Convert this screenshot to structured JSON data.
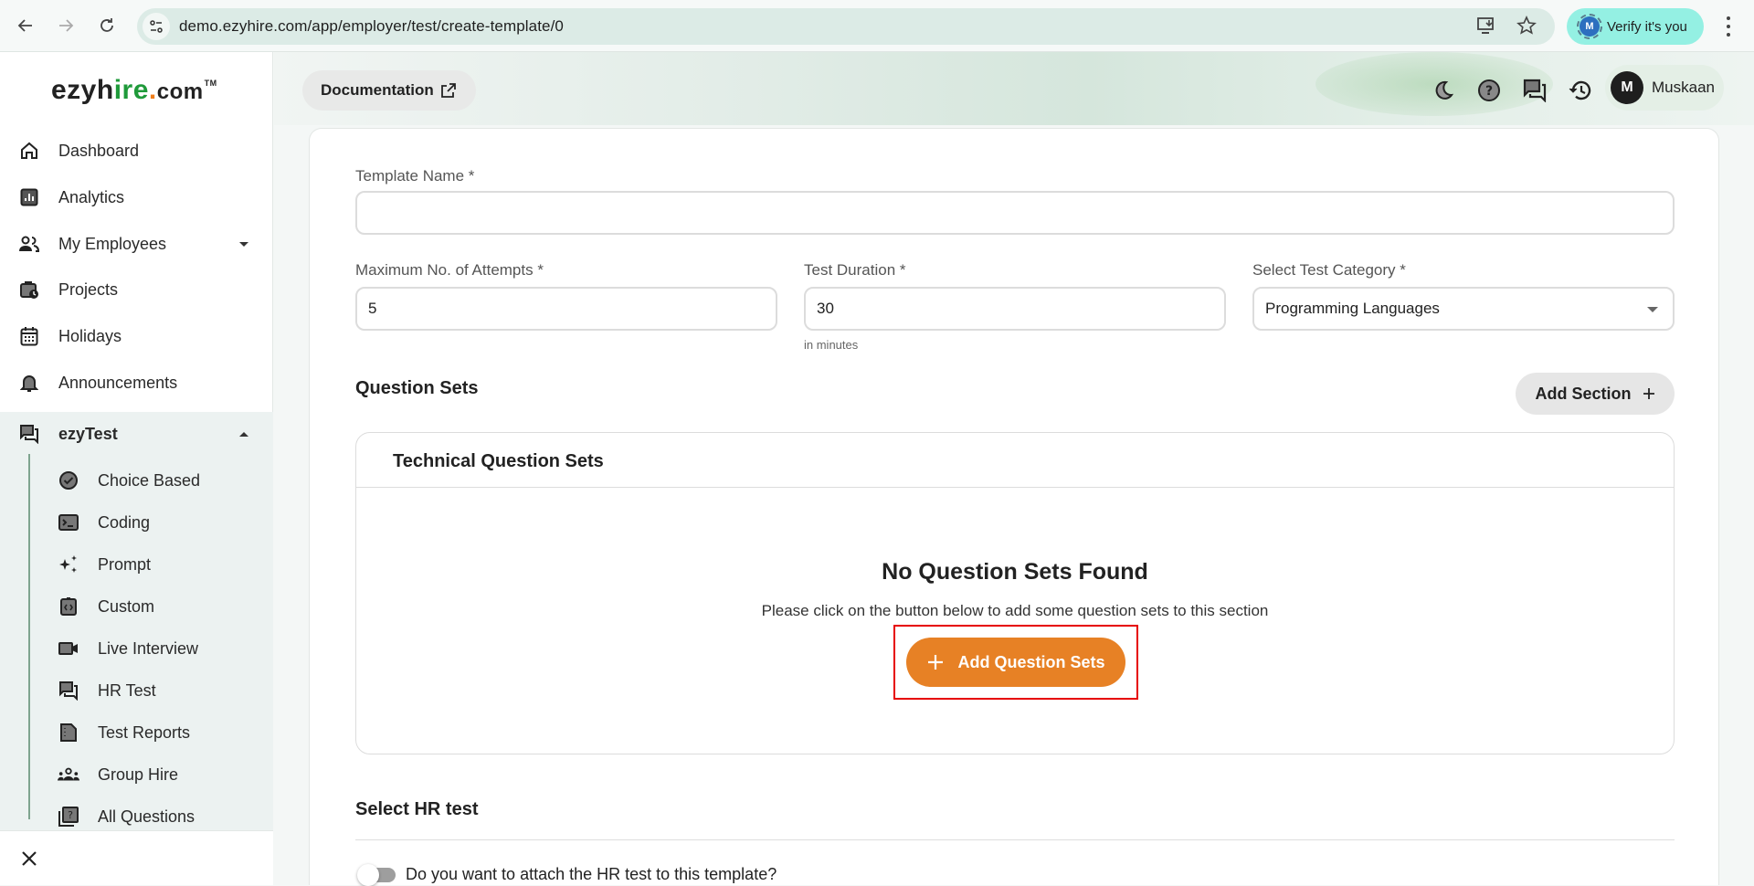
{
  "browser": {
    "url": "demo.ezyhire.com/app/employer/test/create-template/0",
    "profile_button": "Verify it's you",
    "profile_initial": "M"
  },
  "sidebar": {
    "logo": {
      "part1": "ezyh",
      "part2": "ire",
      "dot": ".",
      "part3": "com",
      "tm": "TM"
    },
    "items": [
      {
        "label": "Dashboard",
        "icon": "home-icon"
      },
      {
        "label": "Analytics",
        "icon": "analytics-icon"
      },
      {
        "label": "My Employees",
        "icon": "people-icon",
        "expandable": true,
        "expanded": false
      },
      {
        "label": "Projects",
        "icon": "briefcase-clock-icon"
      },
      {
        "label": "Holidays",
        "icon": "calendar-icon"
      },
      {
        "label": "Announcements",
        "icon": "bell-icon"
      },
      {
        "label": "ezyTest",
        "icon": "forum-icon",
        "expandable": true,
        "expanded": true,
        "active": true
      }
    ],
    "ezytest_items": [
      {
        "label": "Choice Based",
        "icon": "check-circle-icon"
      },
      {
        "label": "Coding",
        "icon": "terminal-icon"
      },
      {
        "label": "Prompt",
        "icon": "sparkles-icon"
      },
      {
        "label": "Custom",
        "icon": "code-clipboard-icon"
      },
      {
        "label": "Live Interview",
        "icon": "video-camera-icon"
      },
      {
        "label": "HR Test",
        "icon": "forum-icon"
      },
      {
        "label": "Test Reports",
        "icon": "report-file-icon"
      },
      {
        "label": "Group Hire",
        "icon": "group-icon"
      },
      {
        "label": "All Questions",
        "icon": "question-library-icon"
      }
    ]
  },
  "header": {
    "documentation_label": "Documentation",
    "user_initial": "M",
    "user_name": "Muskaan"
  },
  "form": {
    "template_name": {
      "label": "Template Name *",
      "value": ""
    },
    "max_attempts": {
      "label": "Maximum No. of Attempts *",
      "value": "5"
    },
    "test_duration": {
      "label": "Test Duration *",
      "value": "30",
      "helper": "in minutes"
    },
    "test_category": {
      "label": "Select Test Category *",
      "value": "Programming Languages"
    }
  },
  "question_sets": {
    "title": "Question Sets",
    "add_section_label": "Add Section",
    "section": {
      "title": "Technical Question Sets",
      "empty_title": "No Question Sets Found",
      "empty_message": "Please click on the button below to add some question sets to this section",
      "add_button_label": "Add Question Sets"
    }
  },
  "hr_test": {
    "title": "Select HR test",
    "toggle_label": "Do you want to attach the HR test to this template?",
    "toggle_on": false
  },
  "colors": {
    "accent_orange": "#e78125",
    "highlight_red": "#e60000",
    "brand_green": "#1f9a3a",
    "sidebar_active_bg": "#ecf2f1"
  }
}
